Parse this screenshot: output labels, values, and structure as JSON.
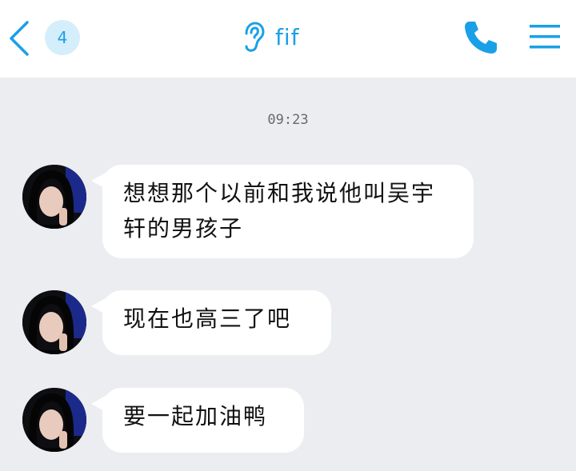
{
  "header": {
    "unread_count": "4",
    "contact_name": "fif",
    "accent_color": "#1aa0e6",
    "icons": [
      "back-arrow-icon",
      "ear-icon",
      "phone-icon",
      "menu-icon"
    ]
  },
  "chat": {
    "timestamp": "09:23",
    "messages": [
      {
        "text": "想想那个以前和我说他叫吴宇轩的男孩子"
      },
      {
        "text": "现在也高三了吧"
      },
      {
        "text": "要一起加油鸭"
      }
    ]
  }
}
